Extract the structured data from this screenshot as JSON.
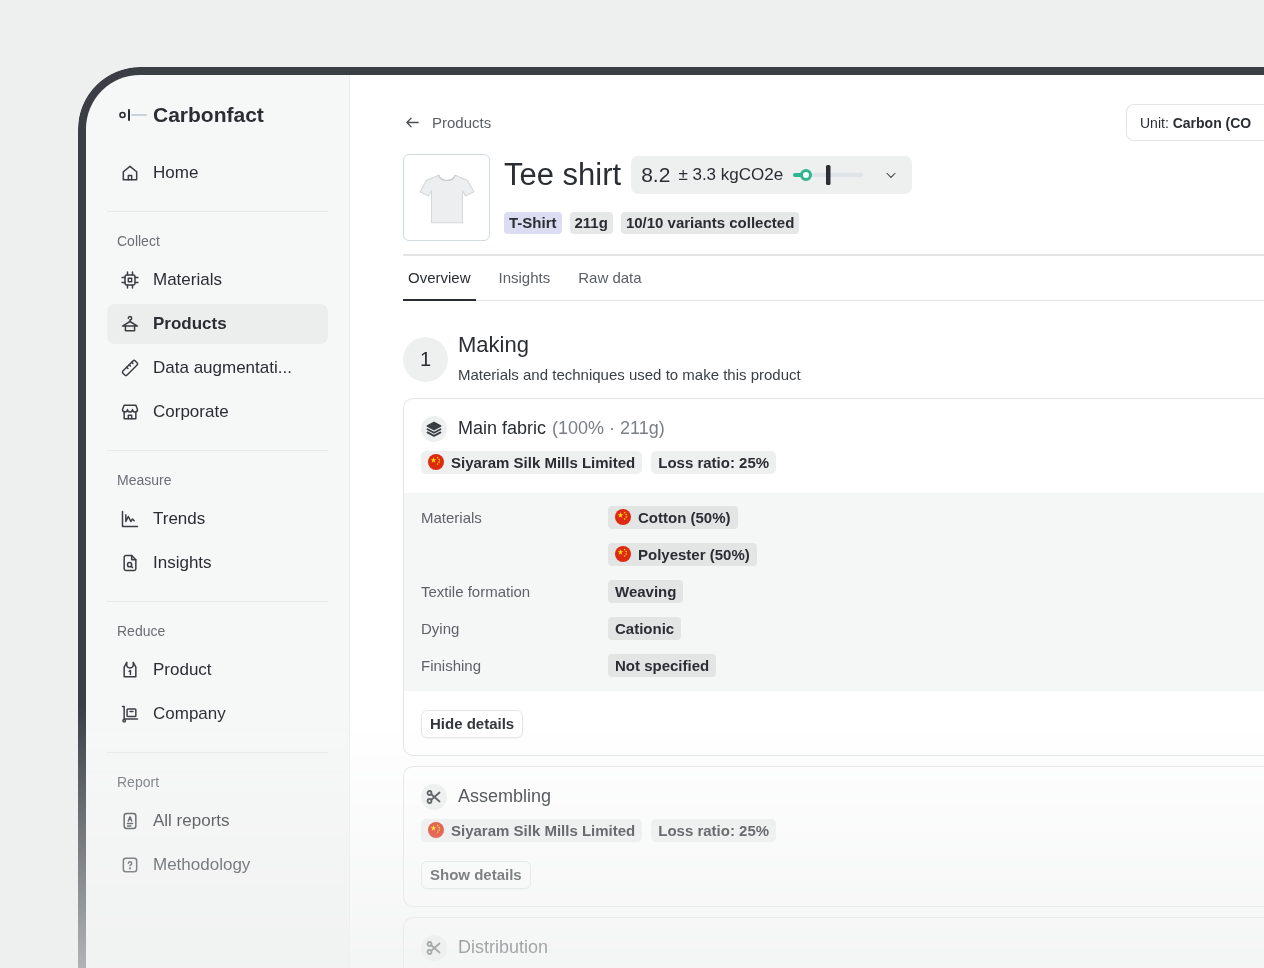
{
  "brand": {
    "name": "Carbonfact"
  },
  "sidebar": {
    "groups": [
      {
        "items": [
          {
            "label": "Home",
            "selected": false
          }
        ]
      },
      {
        "title": "Collect",
        "items": [
          {
            "label": "Materials",
            "selected": false
          },
          {
            "label": "Products",
            "selected": true
          },
          {
            "label": "Data augmentati...",
            "selected": false
          },
          {
            "label": "Corporate",
            "selected": false
          }
        ]
      },
      {
        "title": "Measure",
        "items": [
          {
            "label": "Trends",
            "selected": false
          },
          {
            "label": "Insights",
            "selected": false
          }
        ]
      },
      {
        "title": "Reduce",
        "items": [
          {
            "label": "Product",
            "selected": false
          },
          {
            "label": "Company",
            "selected": false
          }
        ]
      },
      {
        "title": "Report",
        "items": [
          {
            "label": "All reports",
            "selected": false
          },
          {
            "label": "Methodology",
            "selected": false
          }
        ]
      }
    ]
  },
  "breadcrumb": {
    "label": "Products"
  },
  "unit_selector": {
    "label": "Unit: **Carbon (CO**"
  },
  "product": {
    "title": "Tee shirt",
    "footprint": {
      "value": "8.2",
      "range": "± 3.3 kgCO2e"
    },
    "tags": [
      {
        "label": "T-Shirt",
        "color": "#dcdcf2"
      },
      {
        "label": "211g",
        "color": "#e6e7e7"
      },
      {
        "label": "10/10 variants collected",
        "color": "#e6e7e7"
      }
    ]
  },
  "tabs": [
    {
      "label": "Overview",
      "selected": true
    },
    {
      "label": "Insights",
      "selected": false
    },
    {
      "label": "Raw data",
      "selected": false
    }
  ],
  "section": {
    "number": "1",
    "title": "Making",
    "subtitle": "Materials and techniques used to make this product"
  },
  "components": [
    {
      "name": "Main fabric",
      "share": "(100% · 211g)",
      "supplier": "Siyaram Silk Mills Limited",
      "loss_ratio": "Loss ratio: 25%",
      "expanded": true,
      "details": [
        {
          "label": "Materials",
          "values": [
            {
              "kind": "material",
              "text": "Cotton (50%)"
            },
            {
              "kind": "material",
              "text": "Polyester (50%)"
            }
          ]
        },
        {
          "label": "Textile formation",
          "values": [
            {
              "kind": "process",
              "text": "Weaving"
            }
          ]
        },
        {
          "label": "Dying",
          "values": [
            {
              "kind": "process",
              "text": "Cationic"
            }
          ]
        },
        {
          "label": "Finishing",
          "values": [
            {
              "kind": "process",
              "text": "Not specified"
            }
          ]
        }
      ],
      "toggle": "Hide details"
    },
    {
      "name": "Assembling",
      "supplier": "Siyaram Silk Mills Limited",
      "loss_ratio": "Loss ratio: 25%",
      "expanded": false,
      "toggle": "Show details"
    },
    {
      "name": "Distribution"
    }
  ]
}
